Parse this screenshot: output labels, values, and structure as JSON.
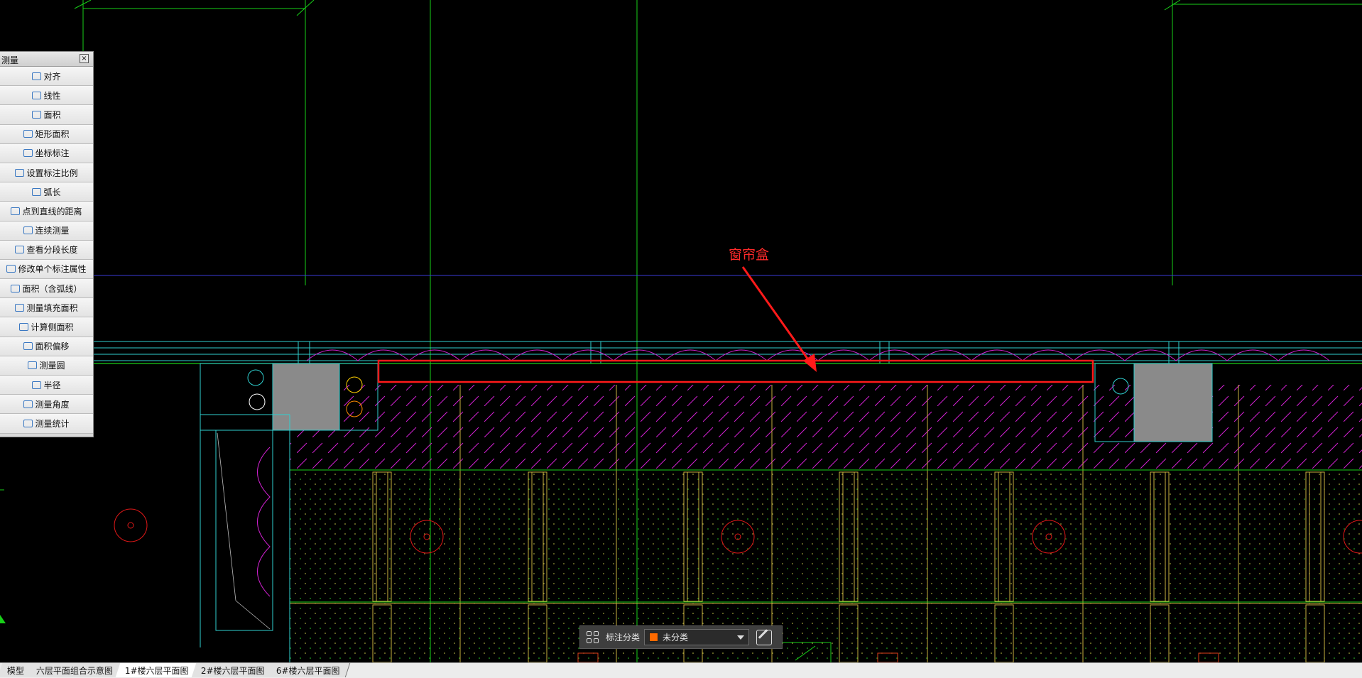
{
  "panel": {
    "title": "测量",
    "close_label": "×",
    "items": [
      {
        "label": "对齐",
        "icon": "aligned-dimension-icon"
      },
      {
        "label": "线性",
        "icon": "linear-dimension-icon"
      },
      {
        "label": "面积",
        "icon": "area-icon"
      },
      {
        "label": "矩形面积",
        "icon": "rect-area-icon"
      },
      {
        "label": "坐标标注",
        "icon": "coordinate-icon"
      },
      {
        "label": "设置标注比例",
        "icon": "scale-icon"
      },
      {
        "label": "弧长",
        "icon": "arc-length-icon"
      },
      {
        "label": "点到直线的距离",
        "icon": "point-line-distance-icon"
      },
      {
        "label": "连续测量",
        "icon": "continuous-measure-icon"
      },
      {
        "label": "查看分段长度",
        "icon": "segment-length-icon"
      },
      {
        "label": "修改单个标注属性",
        "icon": "edit-dimension-icon"
      },
      {
        "label": "面积（含弧线）",
        "icon": "arc-area-icon"
      },
      {
        "label": "测量填充面积",
        "icon": "hatch-area-icon"
      },
      {
        "label": "计算侧面积",
        "icon": "side-area-icon"
      },
      {
        "label": "面积偏移",
        "icon": "area-offset-icon"
      },
      {
        "label": "测量圆",
        "icon": "circle-measure-icon"
      },
      {
        "label": "半径",
        "icon": "radius-icon"
      },
      {
        "label": "测量角度",
        "icon": "angle-icon"
      },
      {
        "label": "测量统计",
        "icon": "statistics-icon"
      }
    ]
  },
  "drawing": {
    "callout_text": "窗帘盒",
    "callout_color": "#ff2a2a"
  },
  "annotation_bar": {
    "label": "标注分类",
    "selected": "未分类",
    "swatch_color": "#ff6a00"
  },
  "tabs": [
    {
      "label": "模型",
      "active": false
    },
    {
      "label": "六层平面组合示意图",
      "active": false
    },
    {
      "label": "1#楼六层平面图",
      "active": true
    },
    {
      "label": "2#楼六层平面图",
      "active": false
    },
    {
      "label": "6#楼六层平面图",
      "active": false
    }
  ]
}
